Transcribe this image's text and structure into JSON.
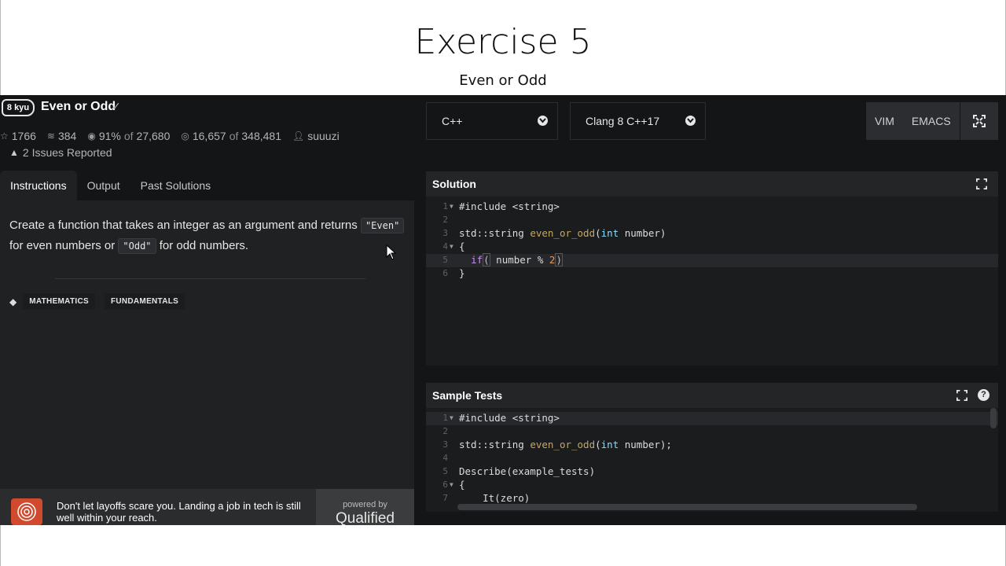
{
  "slide": {
    "title": "Exercise 5",
    "subtitle": "Even or Odd"
  },
  "kata": {
    "rank": "8 kyu",
    "name": "Even or Odd",
    "stats": {
      "stars": "1766",
      "collections": "384",
      "satisfaction": "91%",
      "satisfaction_of": "of",
      "votes": "27,680",
      "completed": "16,657",
      "completed_of": "of",
      "attempts": "348,481",
      "author": "suuuzi"
    },
    "issues": "2 Issues Reported"
  },
  "tabs": [
    "Instructions",
    "Output",
    "Past Solutions"
  ],
  "instructions": {
    "part1": "Create a function that takes an integer as an argument and returns",
    "even": "\"Even\"",
    "part2": "for even numbers or",
    "odd": "\"Odd\"",
    "part3": "for odd numbers."
  },
  "tags": [
    "MATHEMATICS",
    "FUNDAMENTALS"
  ],
  "ad": {
    "text": "Don't let layoffs scare you. Landing a job in tech is still well within your reach.",
    "powered_by": "powered by",
    "brand": "Qualified"
  },
  "toolbar": {
    "language": "C++",
    "version": "Clang 8 C++17",
    "vim": "VIM",
    "emacs": "EMACS"
  },
  "solution": {
    "title": "Solution",
    "lines": [
      {
        "n": "1",
        "t": "#include <string>"
      },
      {
        "n": "2",
        "t": ""
      },
      {
        "n": "3",
        "t": "std::string even_or_odd(int number)"
      },
      {
        "n": "4",
        "t": "{"
      },
      {
        "n": "5",
        "t": "  if( number % 2)"
      },
      {
        "n": "6",
        "t": "}"
      }
    ]
  },
  "sample_tests": {
    "title": "Sample Tests",
    "lines": [
      {
        "n": "1",
        "t": "#include <string>"
      },
      {
        "n": "2",
        "t": ""
      },
      {
        "n": "3",
        "t": "std::string even_or_odd(int number);"
      },
      {
        "n": "4",
        "t": ""
      },
      {
        "n": "5",
        "t": "Describe(example_tests)"
      },
      {
        "n": "6",
        "t": "{"
      },
      {
        "n": "7",
        "t": "    It(zero)"
      }
    ]
  },
  "icons": [
    "check-icon",
    "star-icon",
    "layers-icon",
    "eye-icon",
    "target-icon",
    "user-icon",
    "warning-icon",
    "tag-icon",
    "chevron-down-icon",
    "expand-icon",
    "help-icon"
  ]
}
